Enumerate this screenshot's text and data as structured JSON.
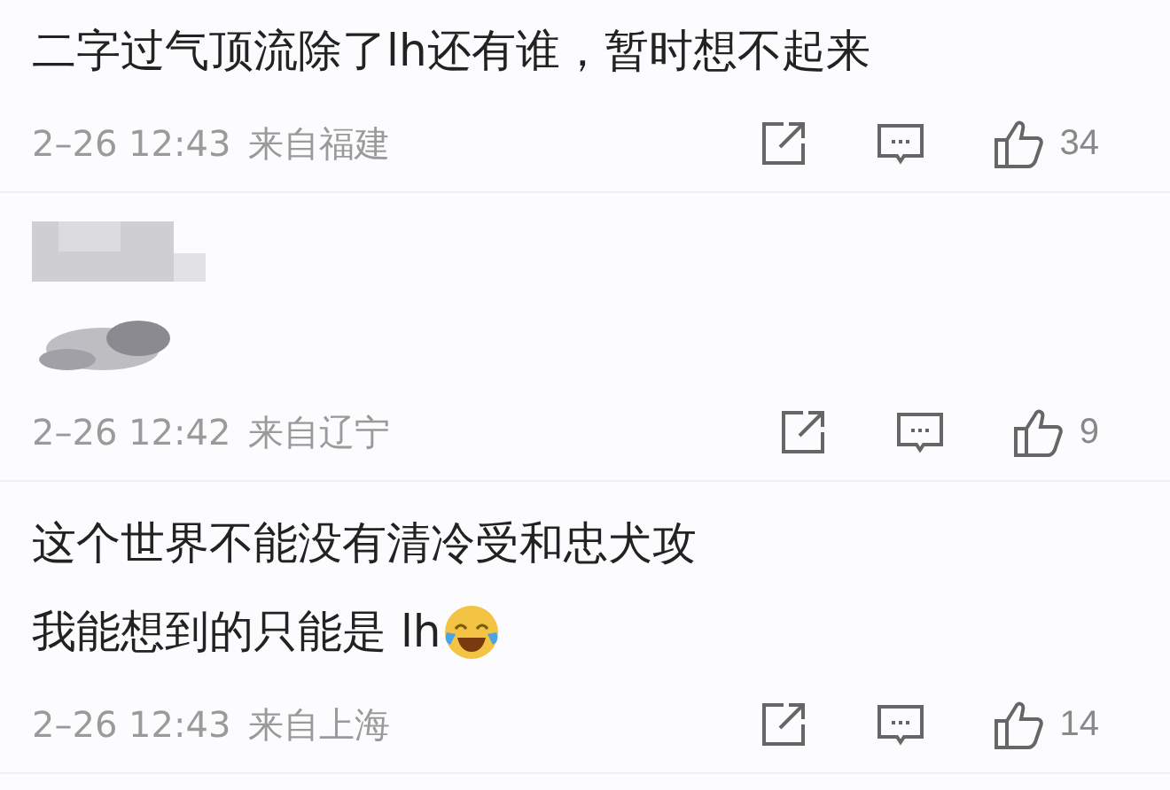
{
  "comments": [
    {
      "kind": "text",
      "lines": [
        "二字过气顶流除了lh还有谁，暂时想不起来"
      ],
      "time": "2–26 12:43",
      "location": "来自福建",
      "likes": "34"
    },
    {
      "kind": "blurred",
      "time": "2–26 12:42",
      "location": "来自辽宁",
      "likes": "9"
    },
    {
      "kind": "text",
      "lines": [
        "这个世界不能没有清冷受和忠犬攻",
        "我能想到的只能是 lh"
      ],
      "emoji_after_last_line": true,
      "time": "2–26 12:43",
      "location": "来自上海",
      "likes": "14"
    }
  ]
}
